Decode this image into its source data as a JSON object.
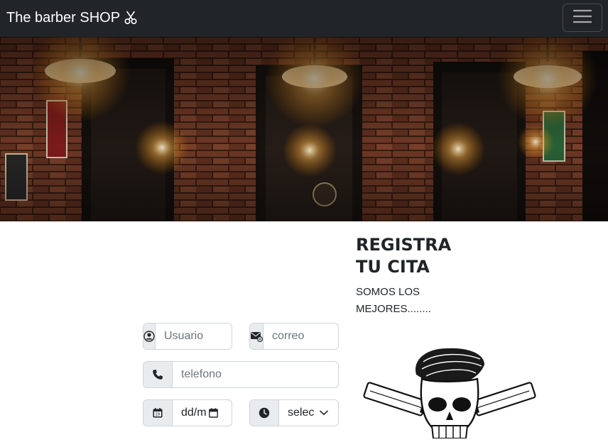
{
  "navbar": {
    "brand": "The barber SHOP",
    "brand_icon": "scissors-icon",
    "toggler_icon": "hamburger-menu-icon"
  },
  "hero": {
    "description_icon": "barbershop-interior-photo"
  },
  "register": {
    "title": "REGISTRA\nTU CITA",
    "subtitle": "SOMOS LOS MEJORES........"
  },
  "form": {
    "usuario_placeholder": "Usuario",
    "correo_placeholder": "correo",
    "telefono_placeholder": "telefono",
    "date_value": "dd/m",
    "time_value": "selec"
  },
  "colors": {
    "navbar_bg": "#212529",
    "input_border": "#ced4da",
    "addon_bg": "#e9ecef"
  }
}
